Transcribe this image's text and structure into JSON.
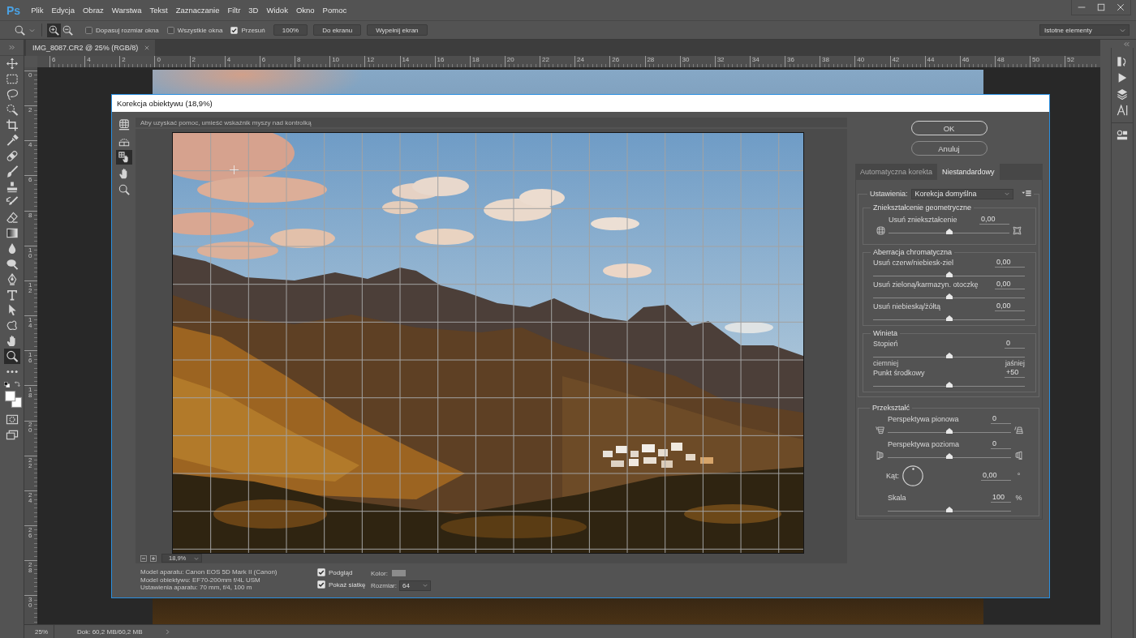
{
  "menu_bar": {
    "logo": "Ps",
    "items": [
      "Plik",
      "Edycja",
      "Obraz",
      "Warstwa",
      "Tekst",
      "Zaznaczanie",
      "Filtr",
      "3D",
      "Widok",
      "Okno",
      "Pomoc"
    ]
  },
  "options_bar": {
    "zoom_modes": [
      {
        "kind": "zoom-in",
        "selected": true
      },
      {
        "kind": "zoom-out",
        "selected": false
      }
    ],
    "checkboxes": [
      {
        "label": "Dopasuj rozmiar okna",
        "checked": false
      },
      {
        "label": "Wszystkie okna",
        "checked": false
      },
      {
        "label": "Przesuń",
        "checked": true
      }
    ],
    "buttons": [
      "100%",
      "Do ekranu",
      "Wypełnij ekran"
    ],
    "workspace": "Istotne elementy"
  },
  "document_tab": {
    "title": "IMG_8087.CR2 @ 25% (RGB/8)"
  },
  "tools": [
    {
      "kind": "move",
      "selected": false
    },
    {
      "kind": "marquee",
      "selected": false
    },
    {
      "kind": "lasso",
      "selected": false
    },
    {
      "kind": "quick-select",
      "selected": false
    },
    {
      "kind": "crop",
      "selected": false
    },
    {
      "kind": "eyedropper",
      "selected": false
    },
    {
      "kind": "healing",
      "selected": false
    },
    {
      "kind": "brush",
      "selected": false
    },
    {
      "kind": "stamp",
      "selected": false
    },
    {
      "kind": "history-brush",
      "selected": false
    },
    {
      "kind": "eraser",
      "selected": false
    },
    {
      "kind": "gradient",
      "selected": false
    },
    {
      "kind": "blur",
      "selected": false
    },
    {
      "kind": "dodge",
      "selected": false
    },
    {
      "kind": "pen",
      "selected": false
    },
    {
      "kind": "type",
      "selected": false
    },
    {
      "kind": "path-select",
      "selected": false
    },
    {
      "kind": "shape",
      "selected": false
    },
    {
      "kind": "hand",
      "selected": false
    },
    {
      "kind": "zoom",
      "selected": true
    },
    {
      "kind": "more",
      "selected": false
    },
    {
      "kind": "quick-mask",
      "selected": false
    },
    {
      "kind": "screen-mode",
      "selected": false
    }
  ],
  "rulers": {
    "horizontal": [
      "6",
      "4",
      "2",
      "0",
      "2",
      "4",
      "6",
      "8",
      "10",
      "12",
      "14",
      "16",
      "18",
      "20",
      "22",
      "24",
      "26",
      "28",
      "30",
      "32",
      "34",
      "36",
      "38",
      "40",
      "42",
      "44",
      "46",
      "48",
      "50",
      "52"
    ],
    "vertical": [
      "0",
      "2",
      "4",
      "6",
      "8",
      "10",
      "12",
      "14",
      "16",
      "18",
      "20",
      "22",
      "24",
      "26",
      "28",
      "30"
    ]
  },
  "status_bar": {
    "zoom": "25%",
    "document": "Dok: 60,2 MB/60,2 MB"
  },
  "dialog": {
    "title": "Korekcja obiektywu (18,9%)",
    "tools": [
      {
        "kind": "remove-distortion",
        "selected": false
      },
      {
        "kind": "straighten",
        "selected": false
      },
      {
        "kind": "move-grid",
        "selected": true
      },
      {
        "kind": "hand",
        "selected": false
      },
      {
        "kind": "zoom",
        "selected": false
      }
    ],
    "help": "Aby uzyskać pomoc, umieść wskaźnik myszy nad kontrolką",
    "preview_zoom": "18,9%",
    "camera_info": [
      "Model aparatu: Canon EOS 5D Mark II (Canon)",
      "Model obiektywu: EF70-200mm f/4L USM",
      "Ustawienia aparatu: 70 mm, f/4, 100 m"
    ],
    "options": [
      {
        "label": "Podgląd",
        "checked": true
      },
      {
        "label": "Pokaż siatkę",
        "checked": true
      }
    ],
    "grid_color_label": "Kolor:",
    "grid_size": {
      "label": "Rozmiar:",
      "value": "64"
    },
    "buttons": [
      "OK",
      "Anuluj"
    ],
    "tabs": [
      {
        "label": "Automatyczna korekta",
        "selected": false
      },
      {
        "label": "Niestandardowy",
        "selected": true
      }
    ],
    "settings": {
      "label": "Ustawienia:",
      "value": "Korekcja domyślna"
    },
    "groups": [
      {
        "title": "Zniekształcenie geometryczne",
        "sliders": [
          {
            "kind": "geometry",
            "label": "Usuń zniekształcenie",
            "value": "0,00",
            "level": 0.5
          }
        ]
      },
      {
        "title": "Aberracja chromatyczna",
        "sliders": [
          {
            "kind": "plain",
            "label": "Usuń czerw/niebiesk-ziel",
            "value": "0,00",
            "level": 0.5
          },
          {
            "kind": "plain",
            "label": "Usuń zieloną/karmazyn. otoczkę",
            "value": "0,00",
            "level": 0.5
          },
          {
            "kind": "plain",
            "label": "Usuń niebieską/żółtą",
            "value": "0,00",
            "level": 0.5
          }
        ]
      },
      {
        "title": "Winieta",
        "sliders": [
          {
            "kind": "plain",
            "label": "Stopień",
            "value": "0",
            "level": 0.5,
            "ends": [
              "ciemniej",
              "jaśniej"
            ]
          },
          {
            "kind": "plain",
            "label": "Punkt środkowy",
            "value": "+50",
            "level": 0.5
          }
        ]
      }
    ],
    "transform": {
      "title": "Przekształć",
      "sliders": [
        {
          "kind": "vertical",
          "label": "Perspektywa pionowa",
          "value": "0",
          "level": 0.5
        },
        {
          "kind": "horizontal",
          "label": "Perspektywa pozioma",
          "value": "0",
          "level": 0.5
        }
      ],
      "angle": {
        "label": "Kąt:",
        "value": "0,00",
        "unit": "°"
      },
      "scale": {
        "kind": "indented",
        "label": "Skala",
        "value": "100",
        "unit": "%",
        "level": 0.5
      }
    }
  }
}
